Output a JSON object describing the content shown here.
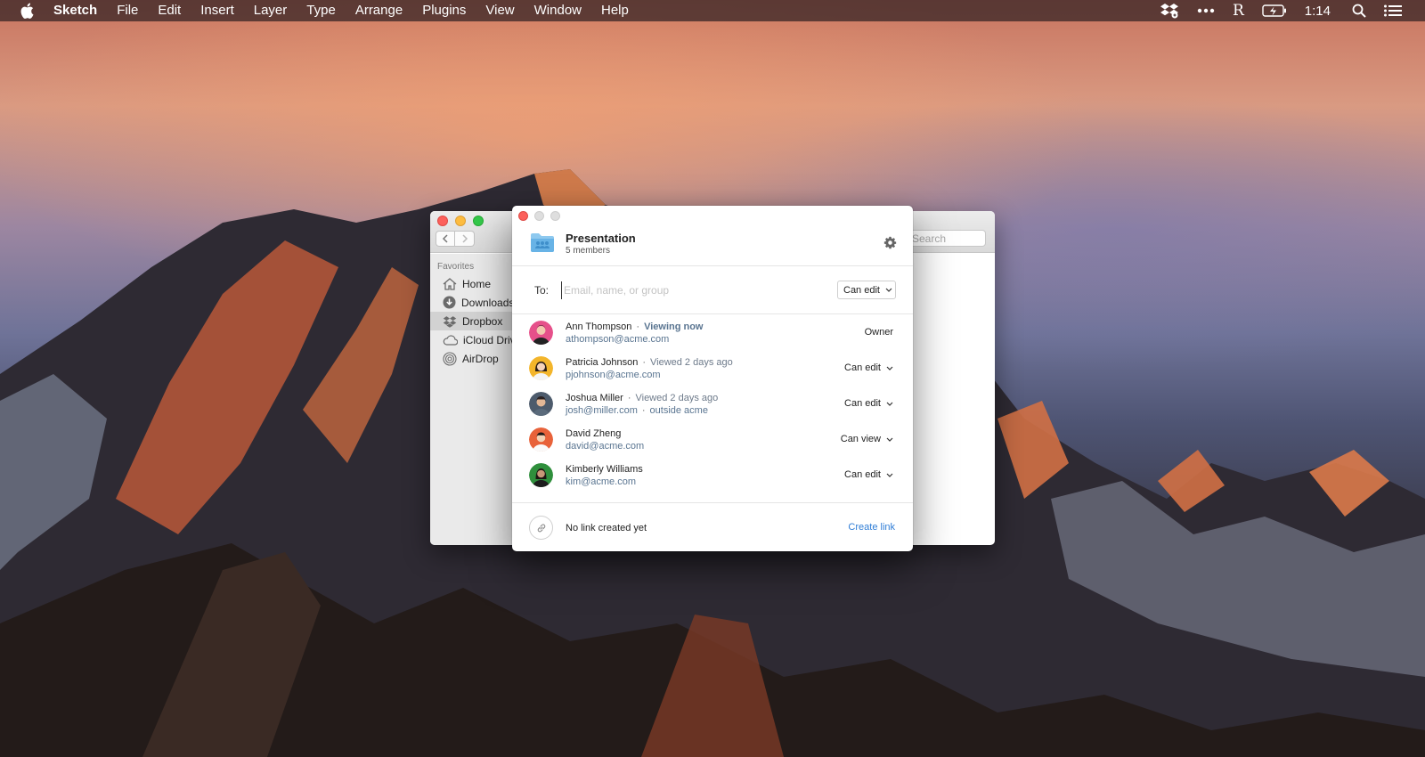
{
  "menubar": {
    "app_name": "Sketch",
    "items": [
      "File",
      "Edit",
      "Insert",
      "Layer",
      "Type",
      "Arrange",
      "Plugins",
      "View",
      "Window",
      "Help"
    ],
    "clock": "1:14",
    "r_icon_letter": "R"
  },
  "finder": {
    "search_placeholder": "Search",
    "sidebar": {
      "section": "Favorites",
      "items": [
        {
          "label": "Home",
          "icon": "home-icon"
        },
        {
          "label": "Downloads",
          "icon": "download-icon"
        },
        {
          "label": "Dropbox",
          "icon": "dropbox-icon"
        },
        {
          "label": "iCloud Drive",
          "icon": "cloud-icon"
        },
        {
          "label": "AirDrop",
          "icon": "airdrop-icon"
        }
      ]
    }
  },
  "dialog": {
    "title": "Presentation",
    "subtitle": "5 members",
    "to_label": "To:",
    "to_placeholder": "Email, name, or group",
    "permission": "Can edit",
    "members": [
      {
        "name": "Ann Thompson",
        "status": "Viewing now",
        "email": "athompson@acme.com",
        "extra": "",
        "role": "Owner",
        "avatar_color": "#e6508a"
      },
      {
        "name": "Patricia Johnson",
        "status": "Viewed 2 days ago",
        "email": "pjohnson@acme.com",
        "extra": "",
        "role": "Can edit",
        "avatar_color": "#f3b52b"
      },
      {
        "name": "Joshua Miller",
        "status": "Viewed 2 days ago",
        "email": "josh@miller.com",
        "extra": "outside acme",
        "role": "Can edit",
        "avatar_color": "#4d5b6c"
      },
      {
        "name": "David Zheng",
        "status": "",
        "email": "david@acme.com",
        "extra": "",
        "role": "Can view",
        "avatar_color": "#e8623a"
      },
      {
        "name": "Kimberly Williams",
        "status": "",
        "email": "kim@acme.com",
        "extra": "",
        "role": "Can edit",
        "avatar_color": "#2f8f3c"
      }
    ],
    "link_text": "No link created yet",
    "create_link": "Create link"
  },
  "colors": {
    "accent_link": "#2f7dd6",
    "email_text": "#5a7591"
  }
}
